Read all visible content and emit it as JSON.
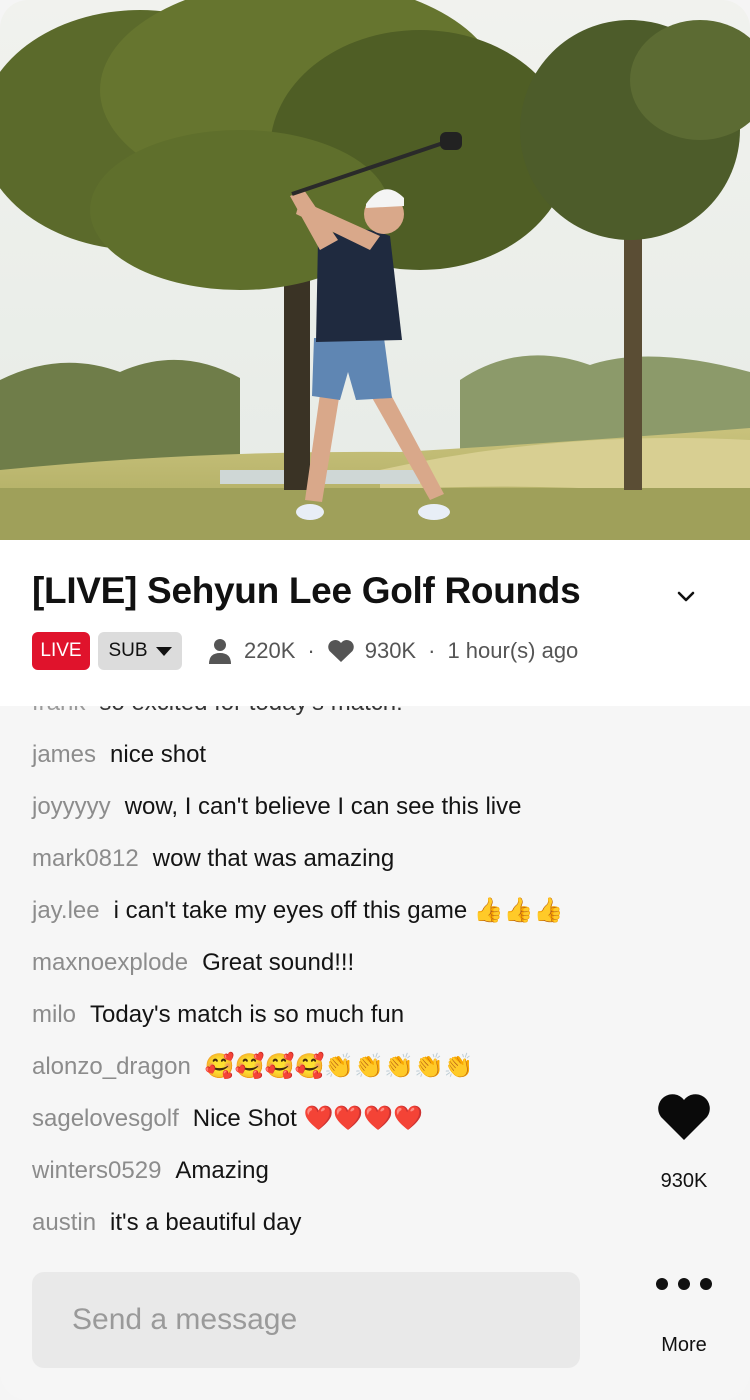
{
  "stream": {
    "title": "[LIVE] Sehyun Lee Golf Rounds",
    "live_badge": "LIVE",
    "sub_label": "SUB",
    "viewers": "220K",
    "likes": "930K",
    "time_ago": "1 hour(s) ago",
    "separator": "·"
  },
  "chat": {
    "partial_row": {
      "user": "frank",
      "message": "so excited for today's match!"
    },
    "messages": [
      {
        "user": "james",
        "message": "nice shot"
      },
      {
        "user": "joyyyyy",
        "message": "wow, I can't believe I can see this live"
      },
      {
        "user": "mark0812",
        "message": "wow that was amazing"
      },
      {
        "user": "jay.lee",
        "message": "i can't take my eyes off this game 👍👍👍"
      },
      {
        "user": "maxnoexplode",
        "message": "Great sound!!!"
      },
      {
        "user": "milo",
        "message": "Today's match is so much fun"
      },
      {
        "user": "alonzo_dragon",
        "message": "🥰🥰🥰🥰👏👏👏👏👏"
      },
      {
        "user": "sagelovesgolf",
        "message": "Nice Shot ❤️❤️❤️❤️"
      },
      {
        "user": "winters0529",
        "message": "Amazing"
      },
      {
        "user": "austin",
        "message": "it's a beautiful day"
      }
    ]
  },
  "actions": {
    "like_count": "930K",
    "more_label": "More"
  },
  "input": {
    "placeholder": "Send a message"
  },
  "colors": {
    "live_red": "#e0132c",
    "username_gray": "#8c8c8c",
    "text_dark": "#141414"
  },
  "icons": {
    "viewers": "person-icon",
    "likes": "heart-icon",
    "collapse": "chevron-down-icon",
    "sub_dropdown": "caret-down-icon",
    "more": "more-dots-icon"
  }
}
